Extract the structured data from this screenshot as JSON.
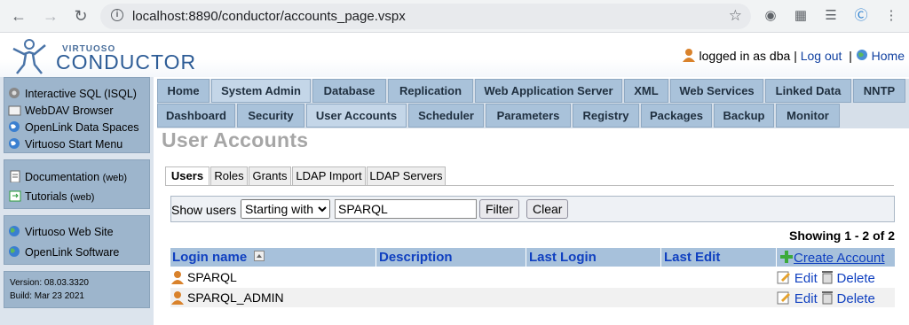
{
  "browser": {
    "url": "localhost:8890/conductor/accounts_page.vspx"
  },
  "header": {
    "logo_small": "VIRTUOSO",
    "logo_big": "CONDUCTOR",
    "logged_in_text": "logged in as dba",
    "sep1": "|",
    "logout_label": "Log out",
    "sep2": "|",
    "home_label": "Home"
  },
  "sidebar": {
    "group1": [
      "Interactive SQL (ISQL)",
      "WebDAV Browser",
      "OpenLink Data Spaces",
      "Virtuoso Start Menu"
    ],
    "group2": [
      {
        "label": "Documentation",
        "suffix": "(web)"
      },
      {
        "label": "Tutorials",
        "suffix": "(web)"
      }
    ],
    "group3": [
      "Virtuoso Web Site",
      "OpenLink Software"
    ],
    "version": "Version: 08.03.3320",
    "build": "Build: Mar 23 2021"
  },
  "tabs_main": [
    "Home",
    "System Admin",
    "Database",
    "Replication",
    "Web Application Server",
    "XML",
    "Web Services",
    "Linked Data",
    "NNTP"
  ],
  "tabs_sub": [
    "Dashboard",
    "Security",
    "User Accounts",
    "Scheduler",
    "Parameters",
    "Registry",
    "Packages",
    "Backup",
    "Monitor"
  ],
  "page_title": "User Accounts",
  "inner_tabs": [
    "Users",
    "Roles",
    "Grants",
    "LDAP Import",
    "LDAP Servers"
  ],
  "filter": {
    "label": "Show users",
    "mode": "Starting with",
    "value": "SPARQL",
    "filter_btn": "Filter",
    "clear_btn": "Clear"
  },
  "showing": "Showing 1 - 2 of 2",
  "table": {
    "columns": [
      "Login name",
      "Description",
      "Last Login",
      "Last Edit"
    ],
    "create_label": "Create Account",
    "edit_label": "Edit",
    "delete_label": "Delete",
    "rows": [
      {
        "login": "SPARQL",
        "description": "",
        "last_login": "",
        "last_edit": ""
      },
      {
        "login": "SPARQL_ADMIN",
        "description": "",
        "last_login": "",
        "last_edit": ""
      }
    ]
  },
  "colors": {
    "tab_bg": "#a9c2da",
    "header_row": "#a7c1db",
    "link": "#1040c0"
  }
}
